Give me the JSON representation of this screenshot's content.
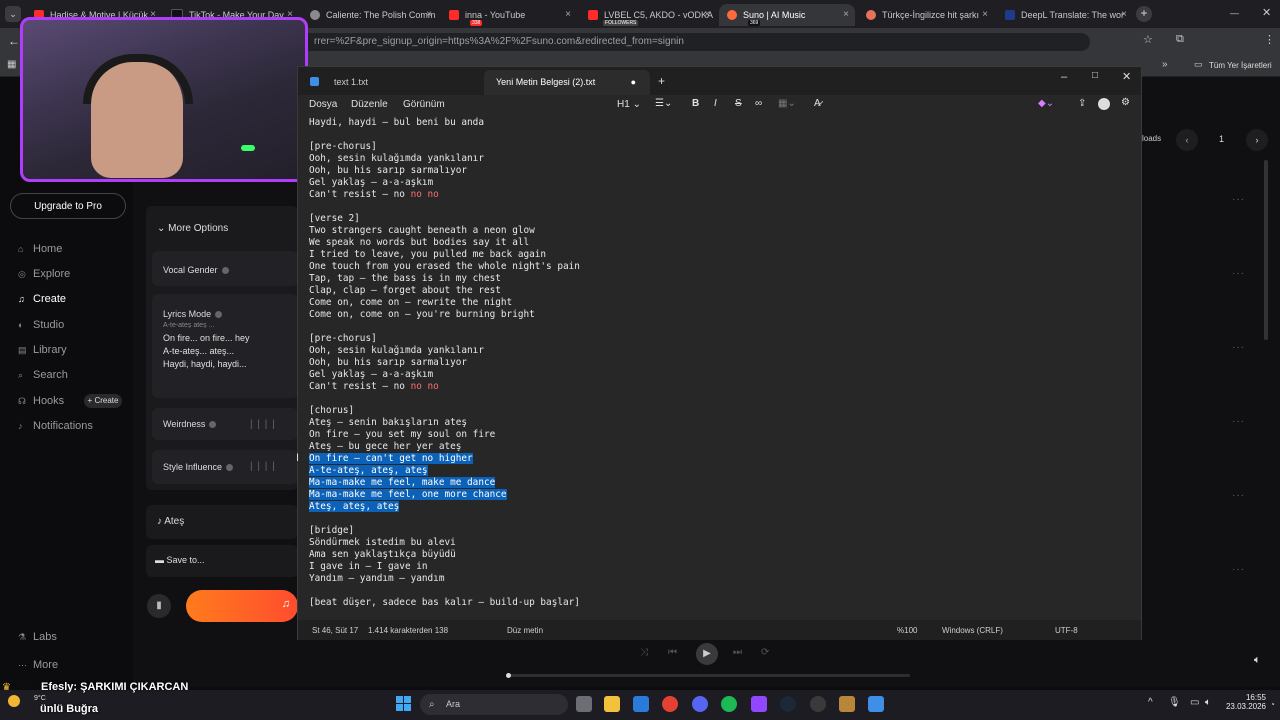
{
  "browser": {
    "tabs": [
      {
        "label": "Hadise & Motive | Küçük",
        "color": "#ff2b2b"
      },
      {
        "label": "TikTok - Make Your Day",
        "color": "#222222"
      },
      {
        "label": "Caliente: The Polish Comm",
        "color": "#8a8a8a"
      },
      {
        "label": "inna - YouTube",
        "color": "#ff2b2b"
      },
      {
        "label": "LVBEL C5, AKDO - vODKA",
        "color": "#ff2b2b"
      },
      {
        "label": "Suno | AI Music",
        "color": "#ff6a3d"
      },
      {
        "label": "Türkçe-İngilizce hit şarkı",
        "color": "#e8715a"
      },
      {
        "label": "DeepL Translate: The wor",
        "color": "#1e3a8a"
      }
    ],
    "url": "rrer=%2F&pre_signup_origin=https%3A%2F%2Fsuno.com&redirected_from=signin",
    "bookmarks_label": "Tüm Yer İşaretleri",
    "tab_badges": {
      "t4": "338",
      "t5": "FOLLOWERS",
      "t6": "369"
    }
  },
  "suno": {
    "upgrade_label": "Upgrade to Pro",
    "nav": [
      {
        "label": "Home",
        "icon": "home-icon"
      },
      {
        "label": "Explore",
        "icon": "compass-icon"
      },
      {
        "label": "Create",
        "icon": "music-note-icon"
      },
      {
        "label": "Studio",
        "icon": "studio-icon"
      },
      {
        "label": "Library",
        "icon": "library-icon"
      },
      {
        "label": "Search",
        "icon": "search-icon"
      },
      {
        "label": "Hooks",
        "icon": "hooks-icon"
      },
      {
        "label": "Notifications",
        "icon": "bell-icon"
      }
    ],
    "create_badge": "+ Create",
    "labs": "Labs",
    "more": "More",
    "more_options": "More Options",
    "vocal_gender": "Vocal Gender",
    "lyrics_mode": "Lyrics Mode",
    "lyrics_preview": [
      "On fire... on fire... hey",
      "A-te-ateş... ateş...",
      "Haydi, haydi, haydi..."
    ],
    "lyrics_cut": "A-te-ateş ateş ...",
    "weirdness": "Weirdness",
    "style_influence": "Style Influence",
    "song_title": "Ateş",
    "save_to": "Save to...",
    "right_header": "loads",
    "page_number": "1"
  },
  "notepad": {
    "tabs": [
      {
        "label": "text 1.txt"
      },
      {
        "label": "Yeni Metin Belgesi (2).txt"
      }
    ],
    "menu": [
      "Dosya",
      "Düzenle",
      "Görünüm"
    ],
    "heading_dropdown": "H1",
    "lines": [
      {
        "text": "Haydi, haydi — bul beni bu anda"
      },
      {
        "text": ""
      },
      {
        "text": "[pre-chorus]"
      },
      {
        "text": "Ooh, sesin kulağımda yankılanır"
      },
      {
        "text": "Ooh, bu his sarıp sarmalıyor"
      },
      {
        "text": "Gel yaklaş — a-a-aşkım"
      },
      {
        "text": "Can't resist — no no no"
      },
      {
        "text": ""
      },
      {
        "text": "[verse 2]"
      },
      {
        "text": "Two strangers caught beneath a neon glow"
      },
      {
        "text": "We speak no words but bodies say it all"
      },
      {
        "text": "I tried to leave, you pulled me back again"
      },
      {
        "text": "One touch from you erased the whole night's pain"
      },
      {
        "text": "Tap, tap — the bass is in my chest"
      },
      {
        "text": "Clap, clap — forget about the rest"
      },
      {
        "text": "Come on, come on — rewrite the night"
      },
      {
        "text": "Come on, come on — you're burning bright"
      },
      {
        "text": ""
      },
      {
        "text": "[pre-chorus]"
      },
      {
        "text": "Ooh, sesin kulağımda yankılanır"
      },
      {
        "text": "Ooh, bu his sarıp sarmalıyor"
      },
      {
        "text": "Gel yaklaş — a-a-aşkım"
      },
      {
        "text": "Can't resist — no no no"
      },
      {
        "text": ""
      },
      {
        "text": "[chorus]"
      },
      {
        "text": "Ateş — senin bakışların ateş"
      },
      {
        "text": "On fire — you set my soul on fire"
      },
      {
        "text": "Ateş — bu gece her yer ateş"
      },
      {
        "text": "On fire — can't get no higher"
      },
      {
        "text": "A-te-ateş, ateş, ateş"
      },
      {
        "text": "Ma-ma-make me feel, make me dance"
      },
      {
        "text": "Ma-ma-make me feel, one more chance"
      },
      {
        "text": "Ateş, ateş, ateş"
      },
      {
        "text": ""
      },
      {
        "text": "[bridge]"
      },
      {
        "text": "Söndürmek istedim bu alevi"
      },
      {
        "text": "Ama sen yaklaştıkça büyüdü"
      },
      {
        "text": "I gave in — I gave in"
      },
      {
        "text": "Yandım — yandım — yandım"
      },
      {
        "text": ""
      },
      {
        "text": "[beat düşer, sadece bas kalır — build-up başlar]"
      }
    ],
    "status": {
      "position": "St 46, Süt 17",
      "chars": "1.414 karakterden 138",
      "format": "Düz metin",
      "zoom": "%100",
      "line_ending": "Windows (CRLF)",
      "encoding": "UTF-8"
    }
  },
  "overlay": {
    "line1": "Efesly: ŞARKIMI ÇIKARCAN",
    "line2": "ünlü Buğra",
    "weather": "9°C"
  },
  "taskbar": {
    "search": "Ara",
    "time": "16:55",
    "date": "23.03.2026"
  },
  "colors": {
    "accent_purple": "#b13dfc",
    "selection": "#0b62b8",
    "create_gradient_start": "#ff7b1c",
    "create_gradient_end": "#ff4d2e"
  }
}
